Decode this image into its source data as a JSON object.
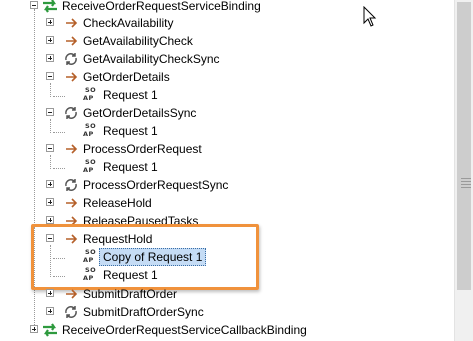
{
  "tree": {
    "binding_top": "ReceiveOrderRequestServiceBinding",
    "binding_bottom": "ReceiveOrderRequestServiceCallbackBinding",
    "operations": {
      "check_availability": "CheckAvailability",
      "get_availability_check": "GetAvailabilityCheck",
      "get_availability_check_sync": "GetAvailabilityCheckSync",
      "get_order_details": "GetOrderDetails",
      "get_order_details_sync": "GetOrderDetailsSync",
      "process_order_request": "ProcessOrderRequest",
      "process_order_request_sync": "ProcessOrderRequestSync",
      "release_hold": "ReleaseHold",
      "release_paused_tasks": "ReleasePausedTasks",
      "request_hold": "RequestHold",
      "submit_draft_order": "SubmitDraftOrder",
      "submit_draft_order_sync": "SubmitDraftOrderSync"
    },
    "requests": {
      "request_1": "Request 1",
      "copy_of_request_1": "Copy of Request 1"
    },
    "soap_icon_text": {
      "line1": "SO",
      "line2": "AP"
    }
  },
  "colors": {
    "highlight_border": "#f0923c",
    "selection_bg": "#c5dcf5",
    "binding_icon": "#2e9a3e",
    "arrow_icon": "#b5602a"
  },
  "icons": {
    "binding": "binding-icon",
    "one_way_operation": "arrow-right-icon",
    "request_response_operation": "cycle-icon",
    "request": "soap-icon"
  }
}
